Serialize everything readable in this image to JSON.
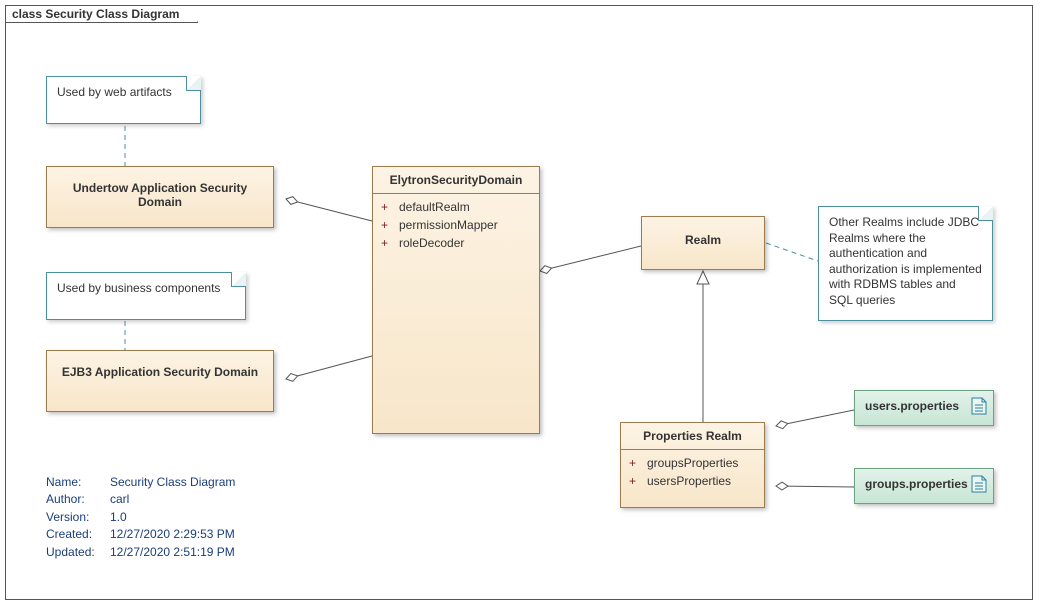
{
  "frame": {
    "title": "class Security Class Diagram"
  },
  "notes": {
    "web": "Used by web artifacts",
    "biz": "Used by business components",
    "realmNote": "Other Realms include JDBC Realms where the authentication and authorization is implemented with RDBMS tables and SQL queries"
  },
  "classes": {
    "undertow": {
      "title": "Undertow Application Security Domain"
    },
    "ejb3": {
      "title": "EJB3 Application Security Domain"
    },
    "elytron": {
      "title": "ElytronSecurityDomain",
      "attrs": [
        "defaultRealm",
        "permissionMapper",
        "roleDecoder"
      ]
    },
    "realm": {
      "title": "Realm"
    },
    "propRealm": {
      "title": "Properties Realm",
      "attrs": [
        "groupsProperties",
        "usersProperties"
      ]
    }
  },
  "artifacts": {
    "users": "users.properties",
    "groups": "groups.properties"
  },
  "meta": {
    "labels": {
      "name": "Name:",
      "author": "Author:",
      "version": "Version:",
      "created": "Created:",
      "updated": "Updated:"
    },
    "values": {
      "name": "Security Class Diagram",
      "author": "carl",
      "version": "1.0",
      "created": "12/27/2020 2:29:53 PM",
      "updated": "12/27/2020 2:51:19 PM"
    }
  }
}
